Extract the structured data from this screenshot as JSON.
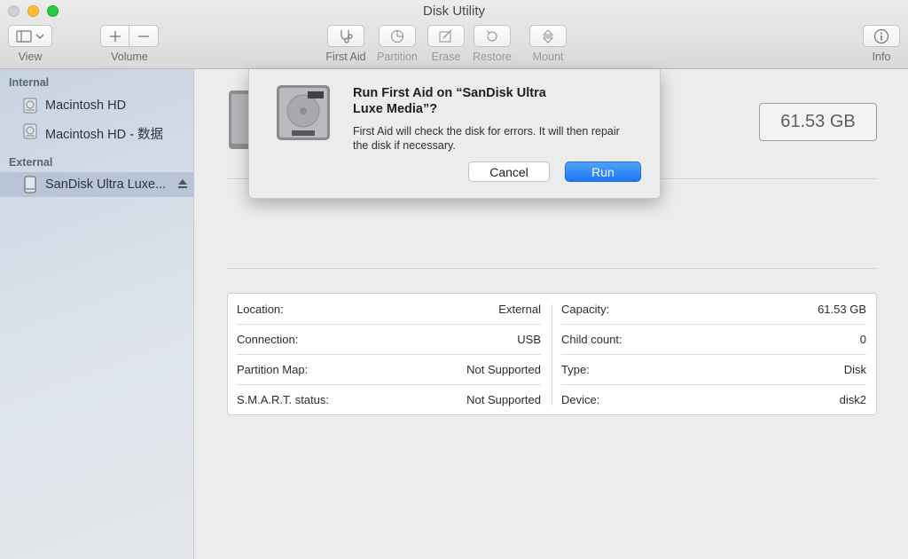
{
  "window": {
    "title": "Disk Utility"
  },
  "toolbar": {
    "view_label": "View",
    "volume_label": "Volume",
    "first_aid_label": "First Aid",
    "partition_label": "Partition",
    "erase_label": "Erase",
    "restore_label": "Restore",
    "mount_label": "Mount",
    "info_label": "Info"
  },
  "sidebar": {
    "internal_heading": "Internal",
    "external_heading": "External",
    "internal_items": [
      {
        "label": "Macintosh HD"
      },
      {
        "label": "Macintosh HD - 数据"
      }
    ],
    "external_items": [
      {
        "label": "SanDisk Ultra Luxe..."
      }
    ]
  },
  "main": {
    "capacity_display": "61.53 GB",
    "info": {
      "location_key": "Location:",
      "location_value": "External",
      "connection_key": "Connection:",
      "connection_value": "USB",
      "partition_map_key": "Partition Map:",
      "partition_map_value": "Not Supported",
      "smart_key": "S.M.A.R.T. status:",
      "smart_value": "Not Supported",
      "capacity_key": "Capacity:",
      "capacity_value": "61.53 GB",
      "child_count_key": "Child count:",
      "child_count_value": "0",
      "type_key": "Type:",
      "type_value": "Disk",
      "device_key": "Device:",
      "device_value": "disk2"
    }
  },
  "dialog": {
    "title": "Run First Aid on “SanDisk Ultra Luxe Media”?",
    "message": "First Aid will check the disk for errors. It will then repair the disk if necessary.",
    "cancel_label": "Cancel",
    "run_label": "Run"
  },
  "icons": {
    "view": "sidebar-icon",
    "add": "plus-icon",
    "remove": "minus-icon",
    "first_aid": "stethoscope-icon",
    "partition": "pie-icon",
    "erase": "pencil-erase-icon",
    "restore": "restore-arrow-icon",
    "mount": "mount-icon",
    "info": "info-icon",
    "disk": "hard-disk-icon",
    "external_disk": "external-drive-icon",
    "eject": "eject-icon"
  },
  "colors": {
    "accent": "#1c77f2",
    "sidebar_selected": "#b9c5d6"
  }
}
